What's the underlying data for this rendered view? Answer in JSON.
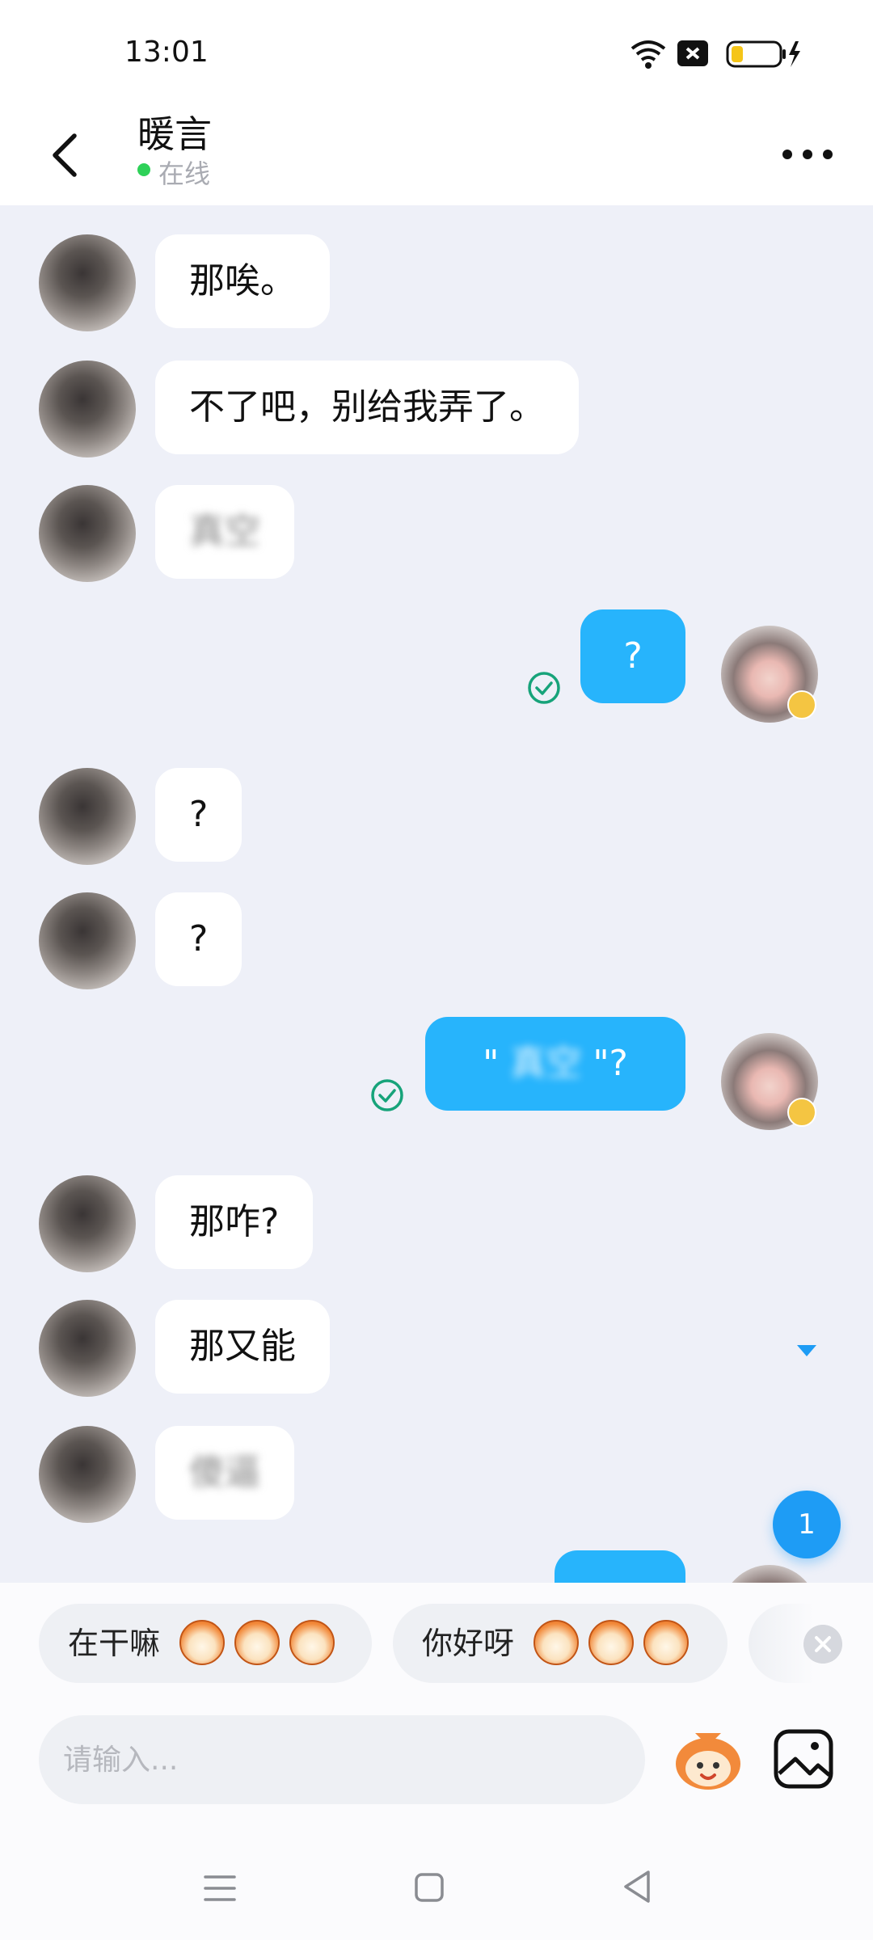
{
  "status_bar": {
    "time": "13:01"
  },
  "header": {
    "contact_name": "暖言",
    "status": "在线"
  },
  "messages": [
    {
      "side": "them",
      "text": "那唉。"
    },
    {
      "side": "them",
      "text": "不了吧，别给我弄了。"
    },
    {
      "side": "them",
      "text": "真空",
      "blurred": true
    },
    {
      "side": "me",
      "text": "?",
      "read": true
    },
    {
      "side": "them",
      "text": "?"
    },
    {
      "side": "them",
      "text": "?"
    },
    {
      "side": "me",
      "text_prefix": "\" ",
      "text_blur": "真空",
      "text_suffix": " \"?",
      "read": true
    },
    {
      "side": "them",
      "text": "那咋?"
    },
    {
      "side": "them",
      "text": "那又能"
    },
    {
      "side": "them",
      "text": "傻逼",
      "blurred": true
    }
  ],
  "unread_count": "1",
  "quick_replies": [
    {
      "label": "在干嘛"
    },
    {
      "label": "你好呀"
    }
  ],
  "input": {
    "placeholder": "请输入..."
  },
  "colors": {
    "my_bubble": "#27b4fc",
    "their_bubble": "#ffffff",
    "online": "#2ed158",
    "read_check": "#17a37a",
    "badge": "#1e9cf5"
  },
  "icons": [
    "back-arrow-icon",
    "more-dots-icon",
    "check-circle-icon",
    "sticker-icon",
    "image-icon",
    "close-icon",
    "menu-icon",
    "home-icon",
    "nav-back-icon",
    "wifi-icon",
    "signal-icon",
    "battery-icon"
  ]
}
